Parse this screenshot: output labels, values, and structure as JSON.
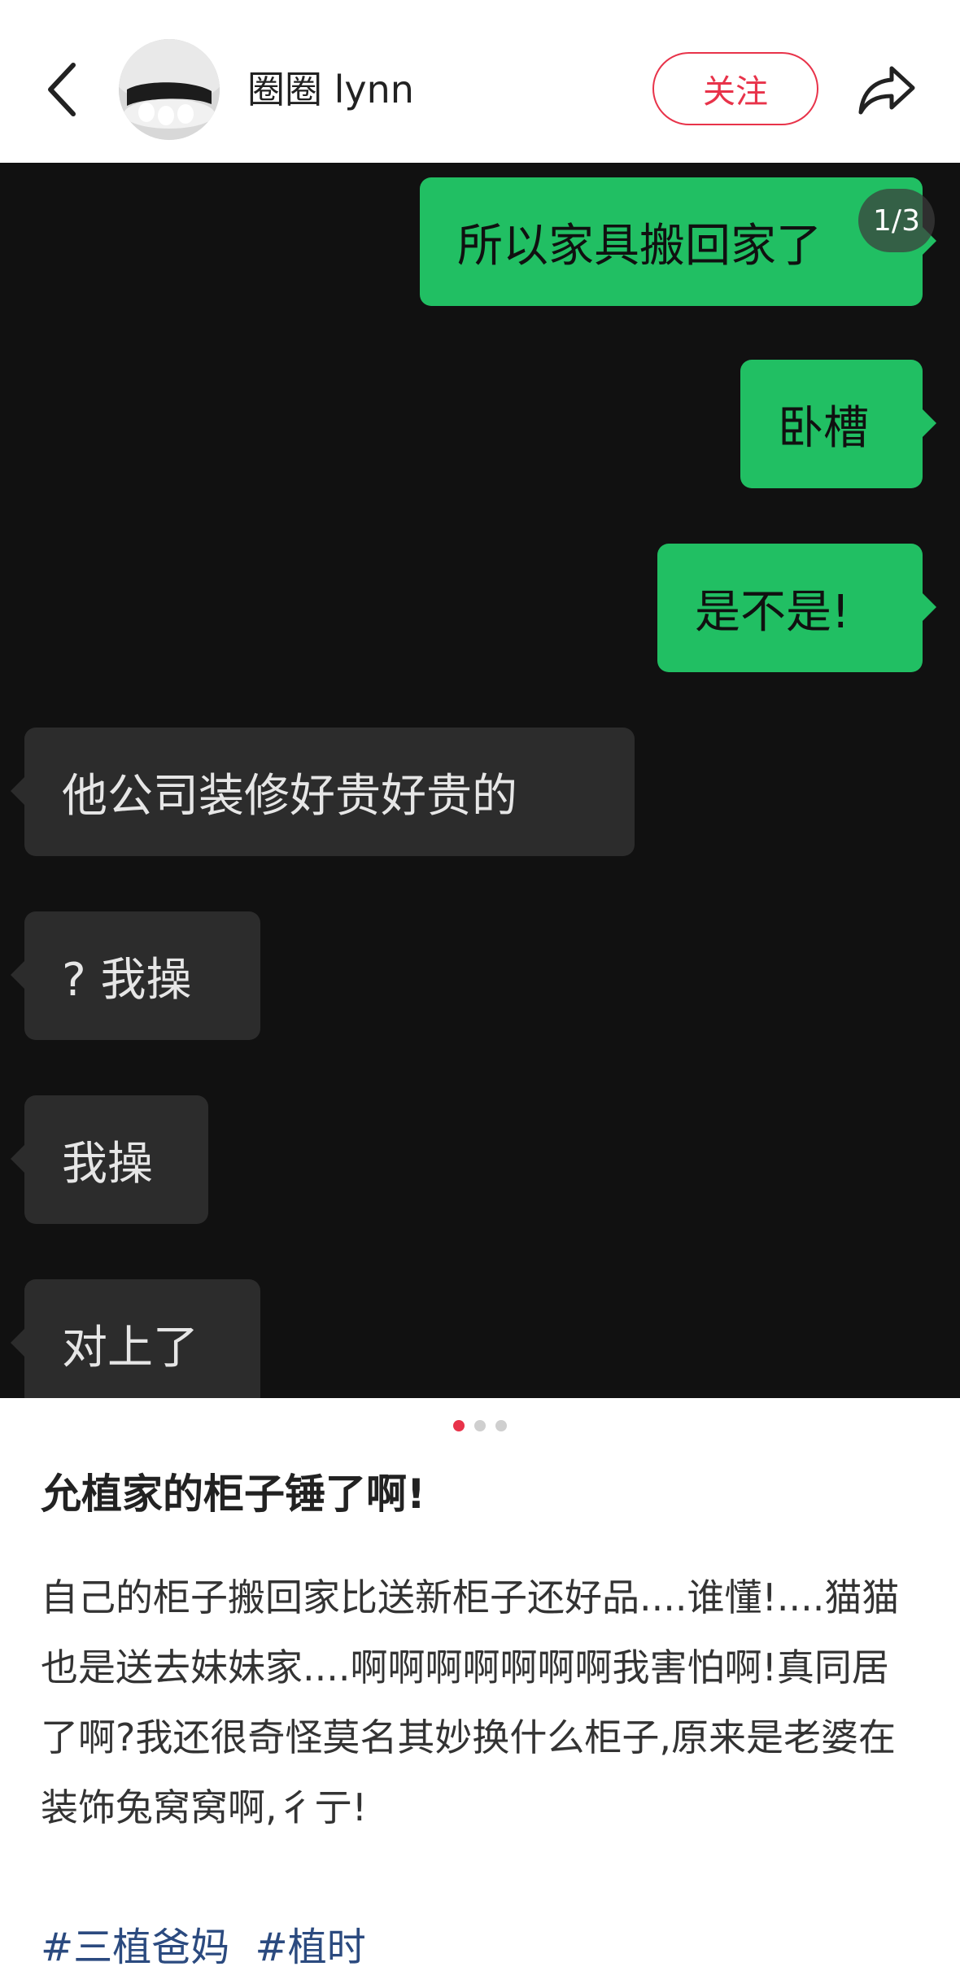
{
  "header": {
    "username": "圈圈 lynn",
    "follow_label": "关注",
    "back_icon": "chevron-left-icon",
    "share_icon": "share-arrow-icon"
  },
  "image": {
    "page_counter": "1/3",
    "total_pages": 3,
    "current_page": 1,
    "messages": [
      {
        "side": "sent",
        "text": "所以家具搬回家了"
      },
      {
        "side": "sent",
        "text": "卧槽"
      },
      {
        "side": "sent",
        "text": "是不是!"
      },
      {
        "side": "recv",
        "text": "他公司装修好贵好贵的"
      },
      {
        "side": "recv",
        "text": "? 我操"
      },
      {
        "side": "recv",
        "text": "我操"
      },
      {
        "side": "recv",
        "text": "对上了"
      }
    ]
  },
  "post": {
    "title": "允植家的柜子锤了啊!",
    "body": "自己的柜子搬回家比送新柜子还好品....谁懂!....猫猫也是送去妹妹家....啊啊啊啊啊啊啊我害怕啊!真同居了啊?我还很奇怪莫名其妙换什么柜子,原来是老婆在装饰兔窝窝啊,彳亍!",
    "tags": [
      "#三植爸妈",
      "#植时"
    ]
  },
  "colors": {
    "accent": "#e8334a",
    "sent_bubble": "#21bf63",
    "recv_bubble": "#2c2c2c",
    "chat_background": "#111111",
    "tag": "#2b4a7f"
  }
}
